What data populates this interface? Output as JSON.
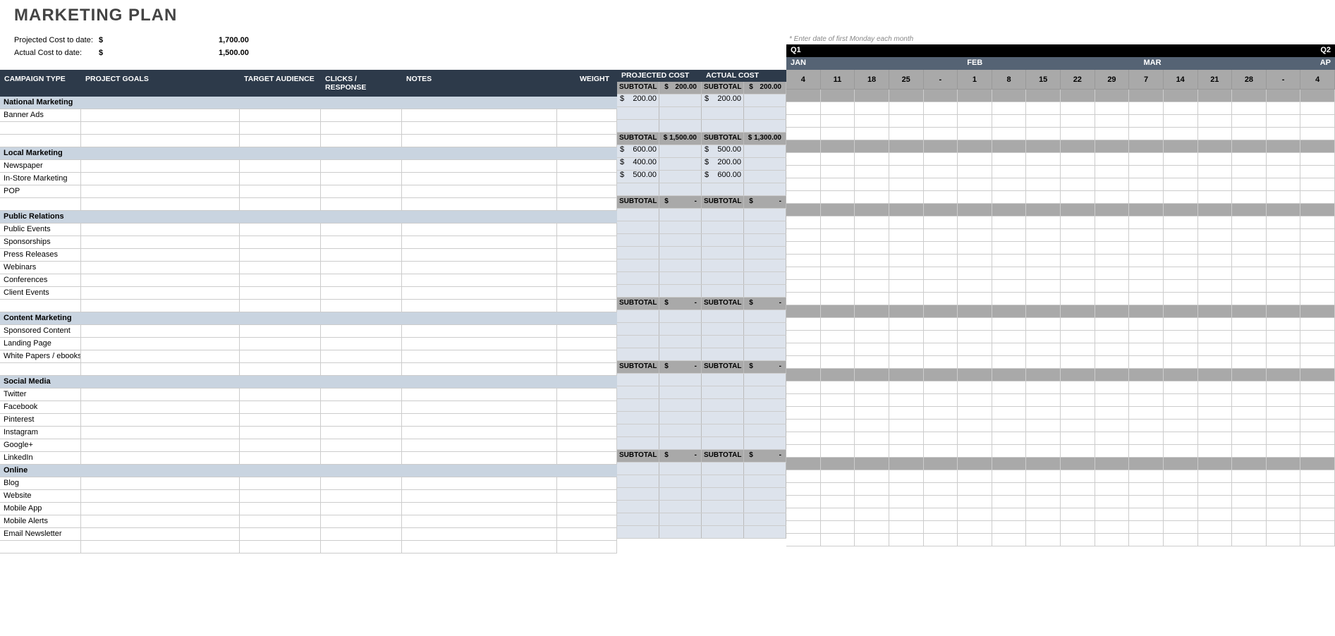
{
  "title": "MARKETING PLAN",
  "summary": {
    "projected_label": "Projected Cost to date:",
    "projected_curr": "$",
    "projected_val": "1,700.00",
    "actual_label": "Actual Cost to date:",
    "actual_curr": "$",
    "actual_val": "1,500.00"
  },
  "timeline": {
    "hint": "* Enter date of first Monday each month",
    "q1": "Q1",
    "q2": "Q2",
    "months": [
      "JAN",
      "FEB",
      "MAR",
      "AP"
    ],
    "days": [
      "4",
      "11",
      "18",
      "25",
      "-",
      "1",
      "8",
      "15",
      "22",
      "29",
      "7",
      "14",
      "21",
      "28",
      "-",
      "4"
    ]
  },
  "headers": {
    "campaign": "CAMPAIGN TYPE",
    "goals": "PROJECT GOALS",
    "audience": "TARGET AUDIENCE",
    "clicks": "CLICKS / RESPONSE",
    "notes": "NOTES",
    "weight": "WEIGHT",
    "projected": "PROJECTED COST",
    "actual": "ACTUAL COST",
    "subtotal": "SUBTOTAL",
    "curr": "$",
    "dash": "-"
  },
  "sections": [
    {
      "name": "National Marketing",
      "proj_sub": "200.00",
      "act_sub": "200.00",
      "items": [
        {
          "name": "Banner Ads",
          "proj": "200.00",
          "act": "200.00"
        },
        {
          "name": "",
          "proj": "",
          "act": ""
        },
        {
          "name": "",
          "proj": "",
          "act": ""
        }
      ]
    },
    {
      "name": "Local Marketing",
      "proj_sub": "1,500.00",
      "act_sub": "1,300.00",
      "items": [
        {
          "name": "Newspaper",
          "proj": "600.00",
          "act": "500.00"
        },
        {
          "name": "In-Store Marketing",
          "proj": "400.00",
          "act": "200.00"
        },
        {
          "name": "POP",
          "proj": "500.00",
          "act": "600.00"
        },
        {
          "name": "",
          "proj": "",
          "act": ""
        }
      ]
    },
    {
      "name": "Public Relations",
      "proj_sub": "-",
      "act_sub": "-",
      "items": [
        {
          "name": "Public Events",
          "proj": "",
          "act": ""
        },
        {
          "name": "Sponsorships",
          "proj": "",
          "act": ""
        },
        {
          "name": "Press Releases",
          "proj": "",
          "act": ""
        },
        {
          "name": "Webinars",
          "proj": "",
          "act": ""
        },
        {
          "name": "Conferences",
          "proj": "",
          "act": ""
        },
        {
          "name": "Client Events",
          "proj": "",
          "act": ""
        },
        {
          "name": "",
          "proj": "",
          "act": ""
        }
      ]
    },
    {
      "name": "Content Marketing",
      "proj_sub": "-",
      "act_sub": "-",
      "items": [
        {
          "name": "Sponsored Content",
          "proj": "",
          "act": ""
        },
        {
          "name": "Landing Page",
          "proj": "",
          "act": ""
        },
        {
          "name": "White Papers / ebooks",
          "proj": "",
          "act": ""
        },
        {
          "name": "",
          "proj": "",
          "act": ""
        }
      ]
    },
    {
      "name": "Social Media",
      "proj_sub": "-",
      "act_sub": "-",
      "items": [
        {
          "name": "Twitter",
          "proj": "",
          "act": ""
        },
        {
          "name": "Facebook",
          "proj": "",
          "act": ""
        },
        {
          "name": "Pinterest",
          "proj": "",
          "act": ""
        },
        {
          "name": "Instagram",
          "proj": "",
          "act": ""
        },
        {
          "name": "Google+",
          "proj": "",
          "act": ""
        },
        {
          "name": "LinkedIn",
          "proj": "",
          "act": ""
        }
      ]
    },
    {
      "name": "Online",
      "proj_sub": "-",
      "act_sub": "-",
      "items": [
        {
          "name": "Blog",
          "proj": "",
          "act": ""
        },
        {
          "name": "Website",
          "proj": "",
          "act": ""
        },
        {
          "name": "Mobile App",
          "proj": "",
          "act": ""
        },
        {
          "name": "Mobile Alerts",
          "proj": "",
          "act": ""
        },
        {
          "name": "Email Newsletter",
          "proj": "",
          "act": ""
        },
        {
          "name": "",
          "proj": "",
          "act": ""
        }
      ]
    }
  ]
}
